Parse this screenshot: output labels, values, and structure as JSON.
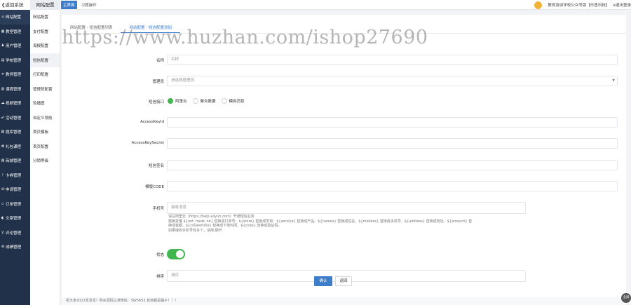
{
  "topbar": {
    "back_label": "❮返回系统",
    "section_title": "网站配置",
    "tabs": [
      {
        "label": "主界面",
        "active": true
      },
      {
        "label": "习题操作",
        "active": false
      }
    ],
    "school_label": "教育培训学校公众号版【乐鱼科技】",
    "logout_label": "⇲退出登录"
  },
  "sidebar": {
    "items": [
      {
        "icon": "⌂",
        "label": "网站配置"
      },
      {
        "icon": "▦",
        "label": "教室管理"
      },
      {
        "icon": "♟",
        "label": "用户管理"
      },
      {
        "icon": "▤",
        "label": "学校管理"
      },
      {
        "icon": "✕",
        "label": "教师管理"
      },
      {
        "icon": "▥",
        "label": "课程管理"
      },
      {
        "icon": "☁",
        "label": "视频管理"
      },
      {
        "icon": "☍",
        "label": "活动管理"
      },
      {
        "icon": "▧",
        "label": "题库管理"
      },
      {
        "icon": "✿",
        "label": "礼包课程"
      },
      {
        "icon": "▨",
        "label": "商城管理"
      },
      {
        "icon": "ᚹ",
        "label": "卡券管理"
      },
      {
        "icon": "☏",
        "label": "申请管理"
      },
      {
        "icon": "⊂",
        "label": "订单管理"
      },
      {
        "icon": "◐",
        "label": "文章管理"
      },
      {
        "icon": "☡",
        "label": "评论管理"
      },
      {
        "icon": "⊛",
        "label": "成绩管理"
      }
    ]
  },
  "submenu": {
    "items": [
      {
        "label": "网站配置",
        "active": false
      },
      {
        "label": "支付配置",
        "active": false
      },
      {
        "label": "海报配置",
        "active": false
      },
      {
        "label": "短信配置",
        "active": true
      },
      {
        "label": "打印配置",
        "active": false
      },
      {
        "label": "管理员配置",
        "active": false
      },
      {
        "label": "轮播图",
        "active": false
      },
      {
        "label": "自定义导航",
        "active": false
      },
      {
        "label": "首页模板",
        "active": false
      },
      {
        "label": "首页配置",
        "active": false
      },
      {
        "label": "分销等级",
        "active": false
      }
    ]
  },
  "inner_tabs": [
    {
      "label": "网站配置 - 短信配置列表",
      "active": false
    },
    {
      "label": "网站配置 - 短信配置添加",
      "active": true
    }
  ],
  "form": {
    "name": {
      "label": "名称",
      "placeholder": "名称"
    },
    "admin": {
      "label": "管理员",
      "placeholder": "请选择管理员"
    },
    "sms_api": {
      "label": "短信接口",
      "options": [
        {
          "label": "阿里云",
          "checked": true
        },
        {
          "label": "聚合数据",
          "checked": false
        },
        {
          "label": "模拟消息",
          "checked": false
        }
      ]
    },
    "access_key_id": {
      "label": "AccessKeyId"
    },
    "access_key_secret": {
      "label": "AccessKeySecret"
    },
    "sign": {
      "label": "短信签名"
    },
    "template_code": {
      "label": "模版CODE"
    },
    "phone": {
      "label": "手机号",
      "placeholder": "接收消息"
    },
    "help_lines": [
      "请在阿里云（https://help.aliyun.com）开通短信业务",
      "模板变量 ${out_trade_no} 替换成订单号、${store} 替换成学校、${service} 替换成产品、${names} 替换成姓名、${mobiles} 替换成手机号、${address} 替换成地址、${amount} 替",
      "换成金额、${createtime} 替换成下单时间、${code} 替换成验证码。",
      "如果接收手机号有多个，请用,隔开"
    ],
    "status": {
      "label": "状态",
      "on": true
    },
    "sort": {
      "label": "排序",
      "placeholder": "排序"
    },
    "confirm_label": "确认",
    "back_label": "返回"
  },
  "footer": {
    "text": "祝大家2023发发发！购买源码认准微信：SW5653 其他都是骗子！！！"
  },
  "fab_label": "全屏",
  "watermark": "https://www.huzhan.com/ishop27690",
  "colors": {
    "primary": "#3d7dca",
    "sidebar": "#213149",
    "success": "#3fb74e"
  }
}
